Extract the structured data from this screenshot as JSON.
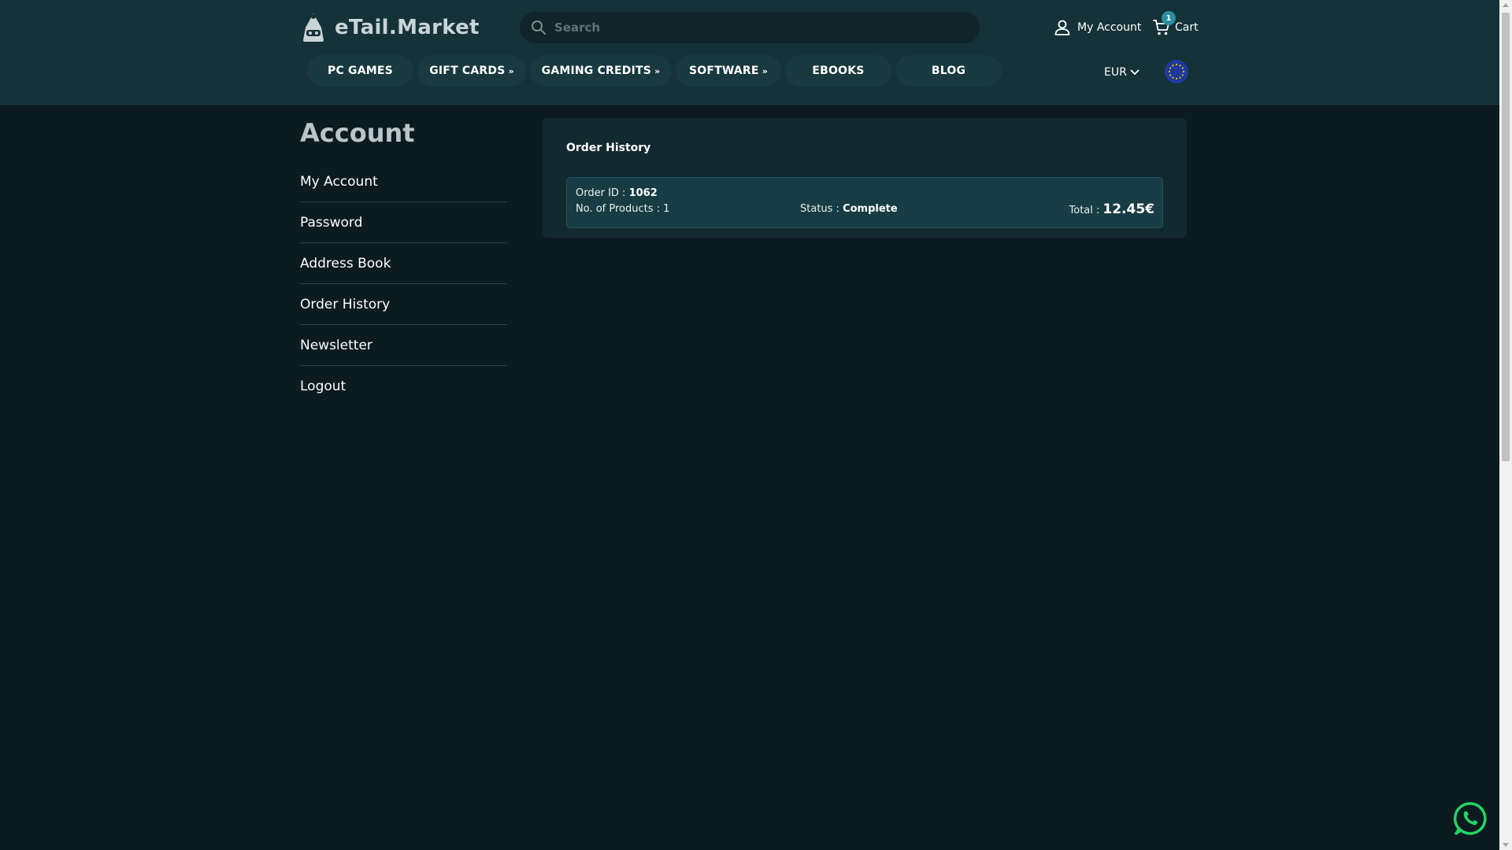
{
  "header": {
    "brand": "eTail.Market",
    "search_placeholder": "Search",
    "account_label": "My Account",
    "cart_label": "Cart",
    "cart_count": "1",
    "currency": "EUR"
  },
  "nav": [
    {
      "label": "PC GAMES",
      "dropdown": false
    },
    {
      "label": "GIFT CARDS",
      "dropdown": true
    },
    {
      "label": "GAMING CREDITS",
      "dropdown": true
    },
    {
      "label": "SOFTWARE",
      "dropdown": true
    },
    {
      "label": "EBOOKS",
      "dropdown": false
    },
    {
      "label": "BLOG",
      "dropdown": false
    }
  ],
  "sidebar": {
    "title": "Account",
    "items": [
      {
        "label": "My Account"
      },
      {
        "label": "Password"
      },
      {
        "label": "Address Book"
      },
      {
        "label": "Order History"
      },
      {
        "label": "Newsletter"
      },
      {
        "label": "Logout"
      }
    ]
  },
  "orders": {
    "title": "Order History",
    "list": [
      {
        "id_label": "Order ID :",
        "id": "1062",
        "products_label": "No. of Products :",
        "products": "1",
        "status_label": "Status :",
        "status": "Complete",
        "total_label": "Total :",
        "total": "12.45€"
      }
    ]
  },
  "icons": {
    "search": "search-icon",
    "account": "user-icon",
    "cart": "cart-icon",
    "currency_chevron": "chevron-down-icon",
    "flag": "eu-flag-icon",
    "chat": "whatsapp-icon"
  },
  "colors": {
    "background": "#0b1b20",
    "header": "#143238",
    "nav_pill": "#17393f",
    "panel": "#122a2f",
    "order_card": "#173c43",
    "badge": "#2a8ea0",
    "whatsapp": "#25d366"
  }
}
